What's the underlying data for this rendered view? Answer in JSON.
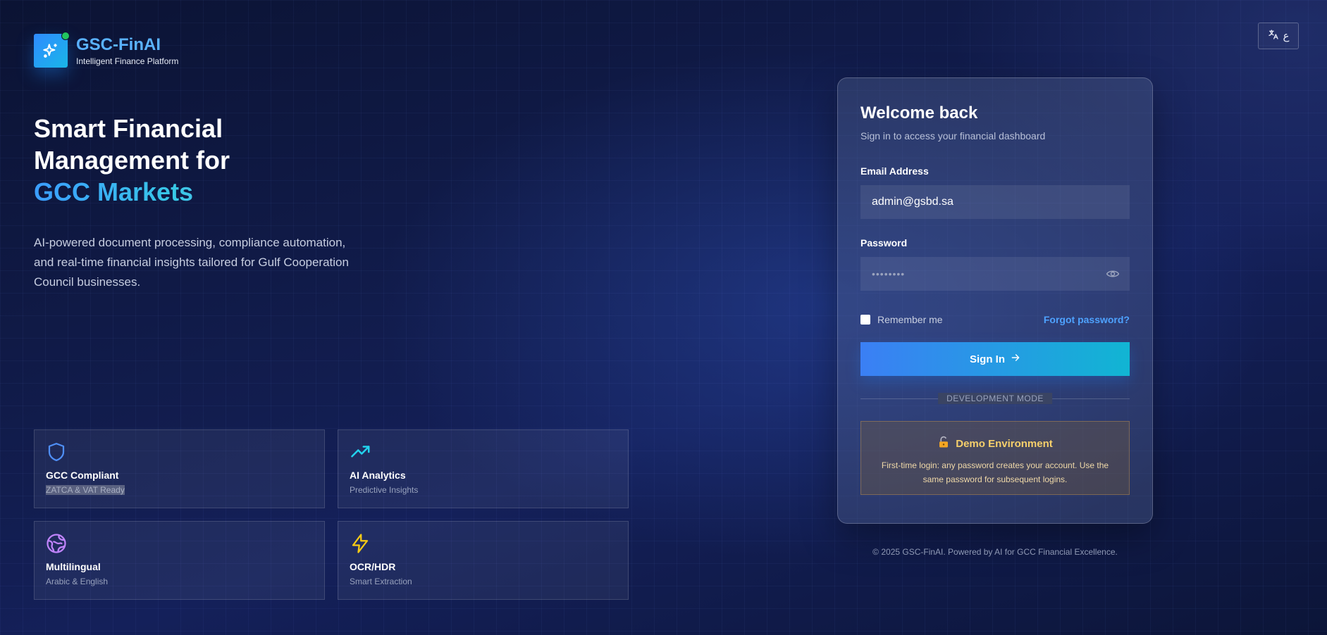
{
  "brand": {
    "name": "GSC-FinAI",
    "tagline": "Intelligent Finance Platform",
    "logo_icon": "sparkles-icon"
  },
  "language_toggle": {
    "icon": "translate-icon",
    "label": "ع"
  },
  "hero": {
    "title_line1": "Smart Financial",
    "title_line2": "Management for",
    "title_highlight": "GCC Markets",
    "description": "AI-powered document processing, compliance automation, and real-time financial insights tailored for Gulf Cooperation Council businesses."
  },
  "features": [
    {
      "icon": "shield-icon",
      "title": "GCC Compliant",
      "subtitle": "ZATCA & VAT Ready",
      "color": "#4f8ff7"
    },
    {
      "icon": "trending-up-icon",
      "title": "AI Analytics",
      "subtitle": "Predictive Insights",
      "color": "#22d3ee"
    },
    {
      "icon": "globe-icon",
      "title": "Multilingual",
      "subtitle": "Arabic & English",
      "color": "#c084fc"
    },
    {
      "icon": "zap-icon",
      "title": "OCR/HDR",
      "subtitle": "Smart Extraction",
      "color": "#facc15"
    }
  ],
  "login": {
    "title": "Welcome back",
    "subtitle": "Sign in to access your financial dashboard",
    "email_label": "Email Address",
    "email_value": "admin@gsbd.sa",
    "password_label": "Password",
    "password_value": "••••••••",
    "remember_label": "Remember me",
    "forgot_label": "Forgot password?",
    "signin_label": "Sign In",
    "mode_label": "DEVELOPMENT MODE"
  },
  "demo": {
    "title": "Demo Environment",
    "text": "First-time login: any password creates your account. Use the same password for subsequent logins."
  },
  "footer": "© 2025 GSC-FinAI. Powered by AI for GCC Financial Excellence."
}
